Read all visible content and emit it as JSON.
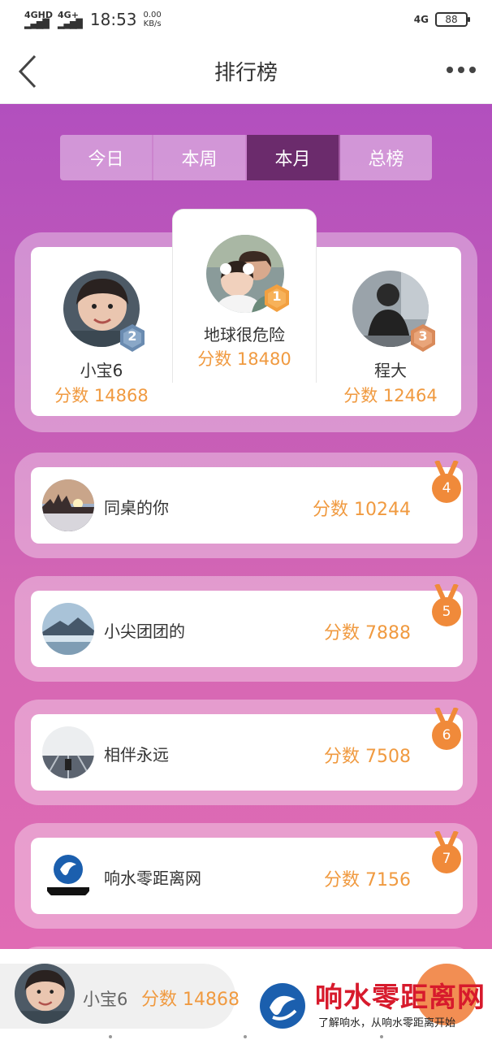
{
  "status_bar": {
    "signal1": "4GHD",
    "signal2": "4G+",
    "time": "18:53",
    "speed_value": "0.00",
    "speed_unit": "KB/s",
    "network_right": "4G",
    "battery": "88"
  },
  "header": {
    "title": "排行榜"
  },
  "tabs": [
    {
      "label": "今日",
      "active": false
    },
    {
      "label": "本周",
      "active": false
    },
    {
      "label": "本月",
      "active": true
    },
    {
      "label": "总榜",
      "active": false
    }
  ],
  "podium": {
    "first": {
      "rank": "1",
      "name": "地球很危险",
      "score": "分数 18480"
    },
    "second": {
      "rank": "2",
      "name": "小宝6",
      "score": "分数 14868"
    },
    "third": {
      "rank": "3",
      "name": "程大",
      "score": "分数 12464"
    }
  },
  "ranking": [
    {
      "rank": "4",
      "name": "同桌的你",
      "score": "分数 10244"
    },
    {
      "rank": "5",
      "name": "小尖团团的",
      "score": "分数 7888"
    },
    {
      "rank": "6",
      "name": "相伴永远",
      "score": "分数 7508"
    },
    {
      "rank": "7",
      "name": "响水零距离网",
      "score": "分数 7156"
    }
  ],
  "self": {
    "name": "小宝6",
    "score": "分数 14868"
  },
  "watermark": {
    "title": "响水零距离网",
    "subtitle": "了解响水，从响水零距离开始"
  },
  "colors": {
    "accent_orange": "#f09a40",
    "tab_active": "#6b2b6c",
    "gradient_top": "#b24fbe",
    "gradient_bottom": "#e06bb4"
  }
}
